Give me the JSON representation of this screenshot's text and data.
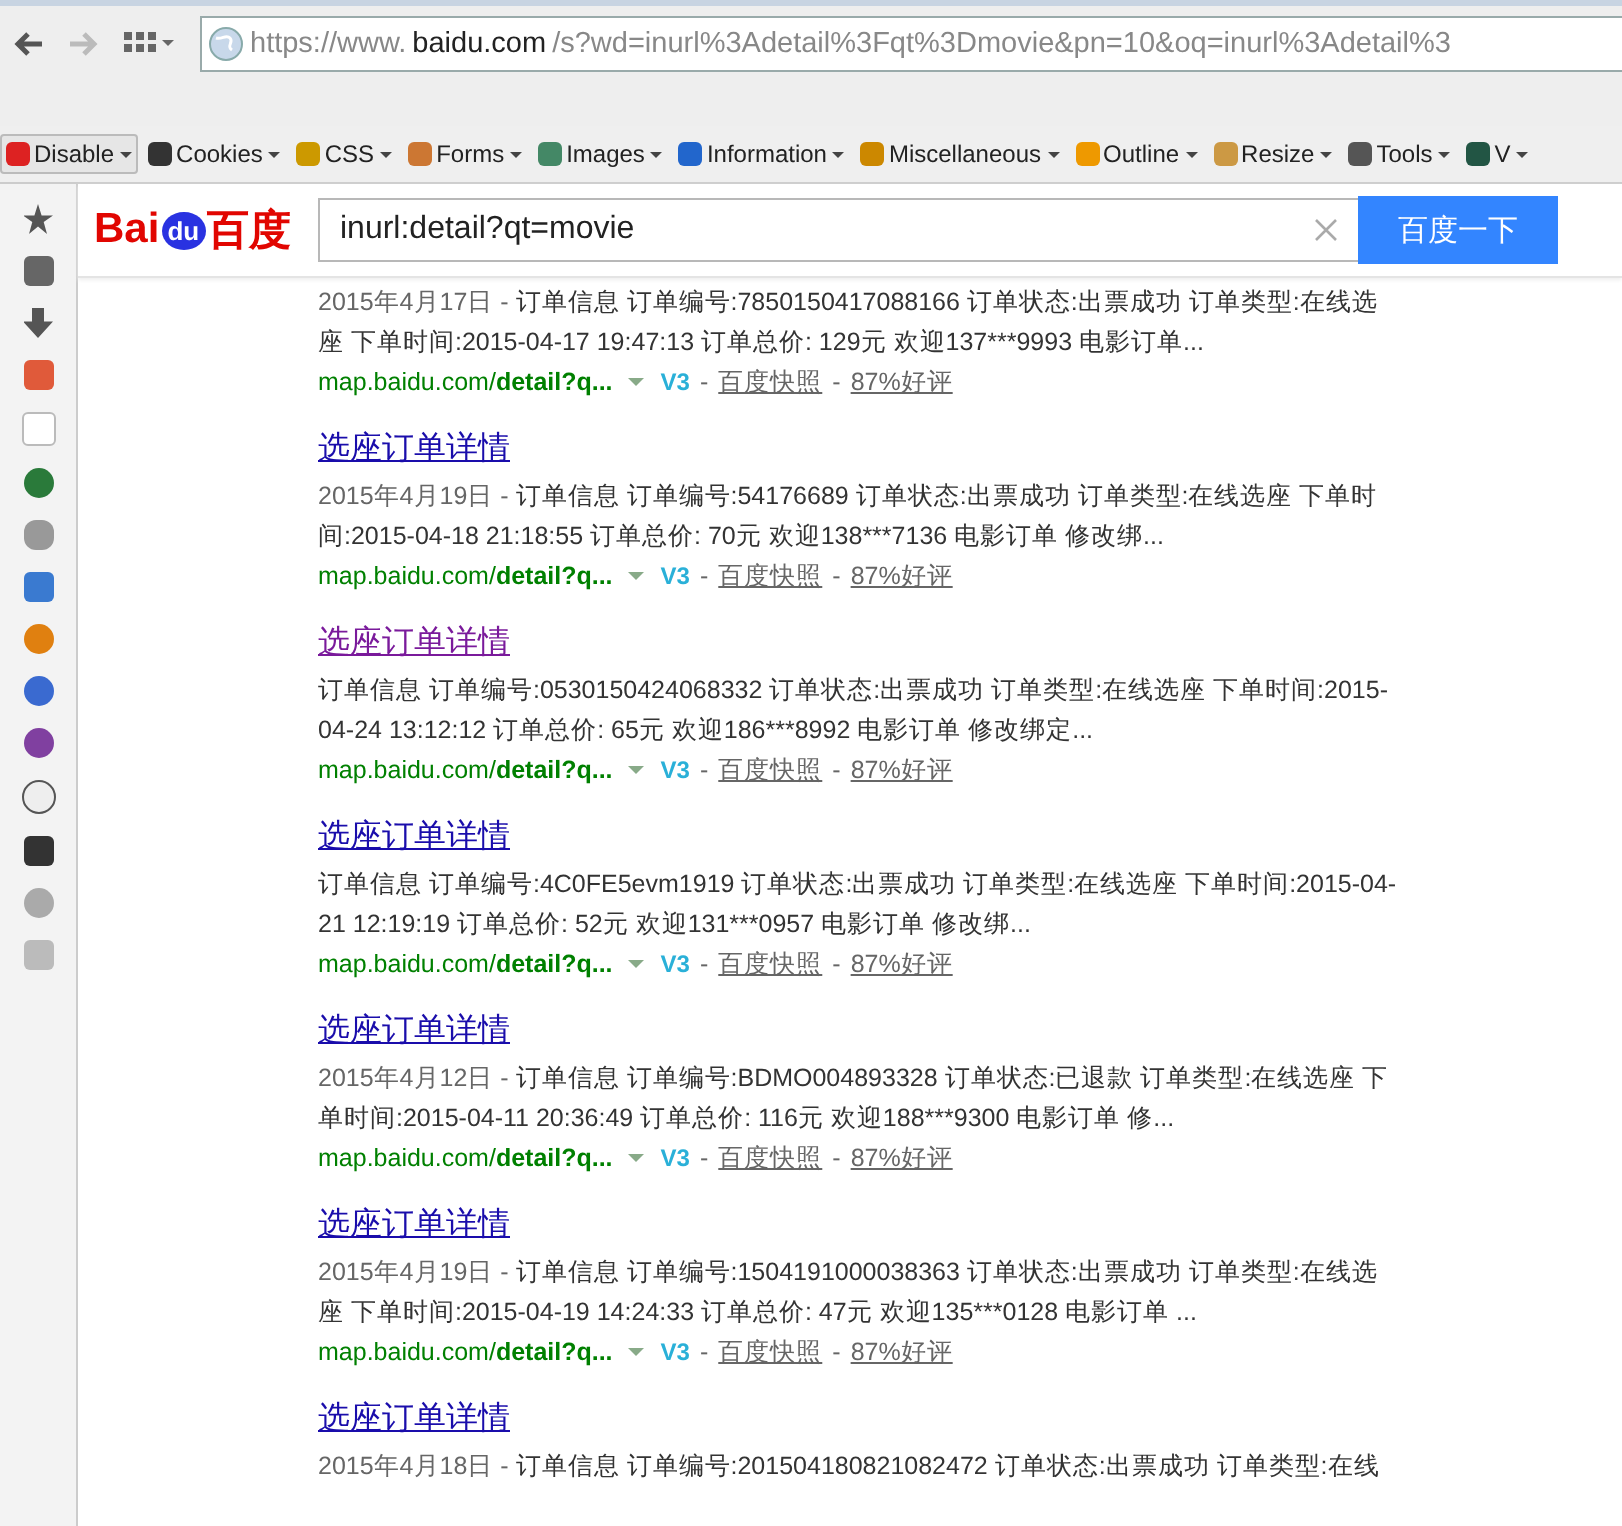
{
  "address_bar": {
    "url_prefix": "https://www.",
    "url_domain": "baidu.com",
    "url_rest": "/s?wd=inurl%3Adetail%3Fqt%3Dmovie&pn=10&oq=inurl%3Adetail%3"
  },
  "toolbar": {
    "items": [
      {
        "label": "Disable"
      },
      {
        "label": "Cookies"
      },
      {
        "label": "CSS"
      },
      {
        "label": "Forms"
      },
      {
        "label": "Images"
      },
      {
        "label": "Information"
      },
      {
        "label": "Miscellaneous"
      },
      {
        "label": "Outline"
      },
      {
        "label": "Resize"
      },
      {
        "label": "Tools"
      },
      {
        "label": "V"
      }
    ]
  },
  "search_header": {
    "logo": {
      "left": "Bai",
      "paw": "du",
      "right": "百度"
    },
    "query": "inurl:detail?qt=movie",
    "button": "百度一下"
  },
  "results": [
    {
      "date": "2015年4月17日 - ",
      "snippet": "订单信息 订单编号:7850150417088166 订单状态:出票成功 订单类型:在线选座 下单时间:2015-04-17 19:47:13 订单总价: 129元 欢迎137***9993 电影订单...",
      "url": "map.baidu.com/**detail?q...**",
      "badge": "V3",
      "dash_1": "-",
      "cache": "百度快照",
      "dash_2": "-",
      "rating": "87%好评"
    },
    {
      "title": "选座订单详情",
      "visited": false,
      "date": "2015年4月19日 - ",
      "snippet": "订单信息 订单编号:54176689 订单状态:出票成功 订单类型:在线选座 下单时间:2015-04-18 21:18:55 订单总价: 70元 欢迎138***7136 电影订单 修改绑...",
      "url": "map.baidu.com/**detail?q...**",
      "badge": "V3",
      "dash_1": "-",
      "cache": "百度快照",
      "dash_2": "-",
      "rating": "87%好评"
    },
    {
      "title": "选座订单详情",
      "visited": true,
      "snippet": "订单信息 订单编号:0530150424068332 订单状态:出票成功 订单类型:在线选座 下单时间:2015-04-24 13:12:12 订单总价: 65元 欢迎186***8992 电影订单 修改绑定...",
      "url": "map.baidu.com/**detail?q...**",
      "badge": "V3",
      "dash_1": "-",
      "cache": "百度快照",
      "dash_2": "-",
      "rating": "87%好评"
    },
    {
      "title": "选座订单详情",
      "visited": false,
      "snippet": "订单信息 订单编号:4C0FE5evm1919 订单状态:出票成功 订单类型:在线选座 下单时间:2015-04-21 12:19:19 订单总价: 52元 欢迎131***0957 电影订单 修改绑...",
      "url": "map.baidu.com/**detail?q...**",
      "badge": "V3",
      "dash_1": "-",
      "cache": "百度快照",
      "dash_2": "-",
      "rating": "87%好评"
    },
    {
      "title": "选座订单详情",
      "visited": false,
      "date": "2015年4月12日 - ",
      "snippet": "订单信息 订单编号:BDMO004893328 订单状态:已退款 订单类型:在线选座 下单时间:2015-04-11 20:36:49 订单总价: 116元 欢迎188***9300 电影订单 修...",
      "url": "map.baidu.com/**detail?q...**",
      "badge": "V3",
      "dash_1": "-",
      "cache": "百度快照",
      "dash_2": "-",
      "rating": "87%好评"
    },
    {
      "title": "选座订单详情",
      "visited": false,
      "date": "2015年4月19日 - ",
      "snippet": "订单信息 订单编号:1504191000038363 订单状态:出票成功 订单类型:在线选座 下单时间:2015-04-19 14:24:33 订单总价: 47元 欢迎135***0128 电影订单 ...",
      "url": "map.baidu.com/**detail?q...**",
      "badge": "V3",
      "dash_1": "-",
      "cache": "百度快照",
      "dash_2": "-",
      "rating": "87%好评"
    },
    {
      "title": "选座订单详情",
      "visited": false,
      "date": "2015年4月18日 - ",
      "snippet": "订单信息 订单编号:201504180821082472 订单状态:出票成功 订单类型:在线"
    }
  ]
}
